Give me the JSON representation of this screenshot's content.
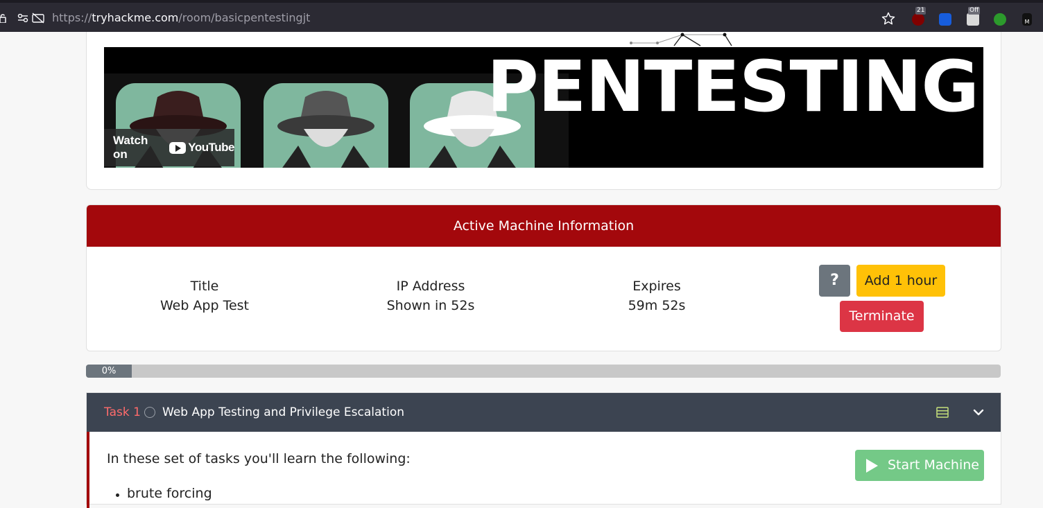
{
  "browser": {
    "url_prefix": "https://",
    "url_host": "tryhackme.com",
    "url_path": "/room/basicpentestingjt",
    "extensions": {
      "ublock_badge": "21",
      "cookie_badge": "Off",
      "m_label": "M"
    }
  },
  "video": {
    "banner_text": "PENTESTING",
    "watch_on_label": "Watch on",
    "youtube_label": "YouTube"
  },
  "machine": {
    "header": "Active Machine Information",
    "title_label": "Title",
    "title_value": "Web App Test",
    "ip_label": "IP Address",
    "ip_value": "Shown in 52s",
    "expires_label": "Expires",
    "expires_value": "59m 52s",
    "help_label": "?",
    "add_hour_label": "Add 1 hour",
    "terminate_label": "Terminate"
  },
  "progress": {
    "label": "0%",
    "value": 0
  },
  "task": {
    "number": "Task 1",
    "title": "Web App Testing and Privilege Escalation",
    "intro": "In these set of tasks you'll learn the following:",
    "bullets": [
      "brute forcing"
    ],
    "start_label": "Start Machine"
  },
  "colors": {
    "machine_header": "#a3080c",
    "add_hour": "#ffc107",
    "terminate": "#dc3545",
    "task_header": "#3c4451",
    "start_machine": "#74c987"
  }
}
